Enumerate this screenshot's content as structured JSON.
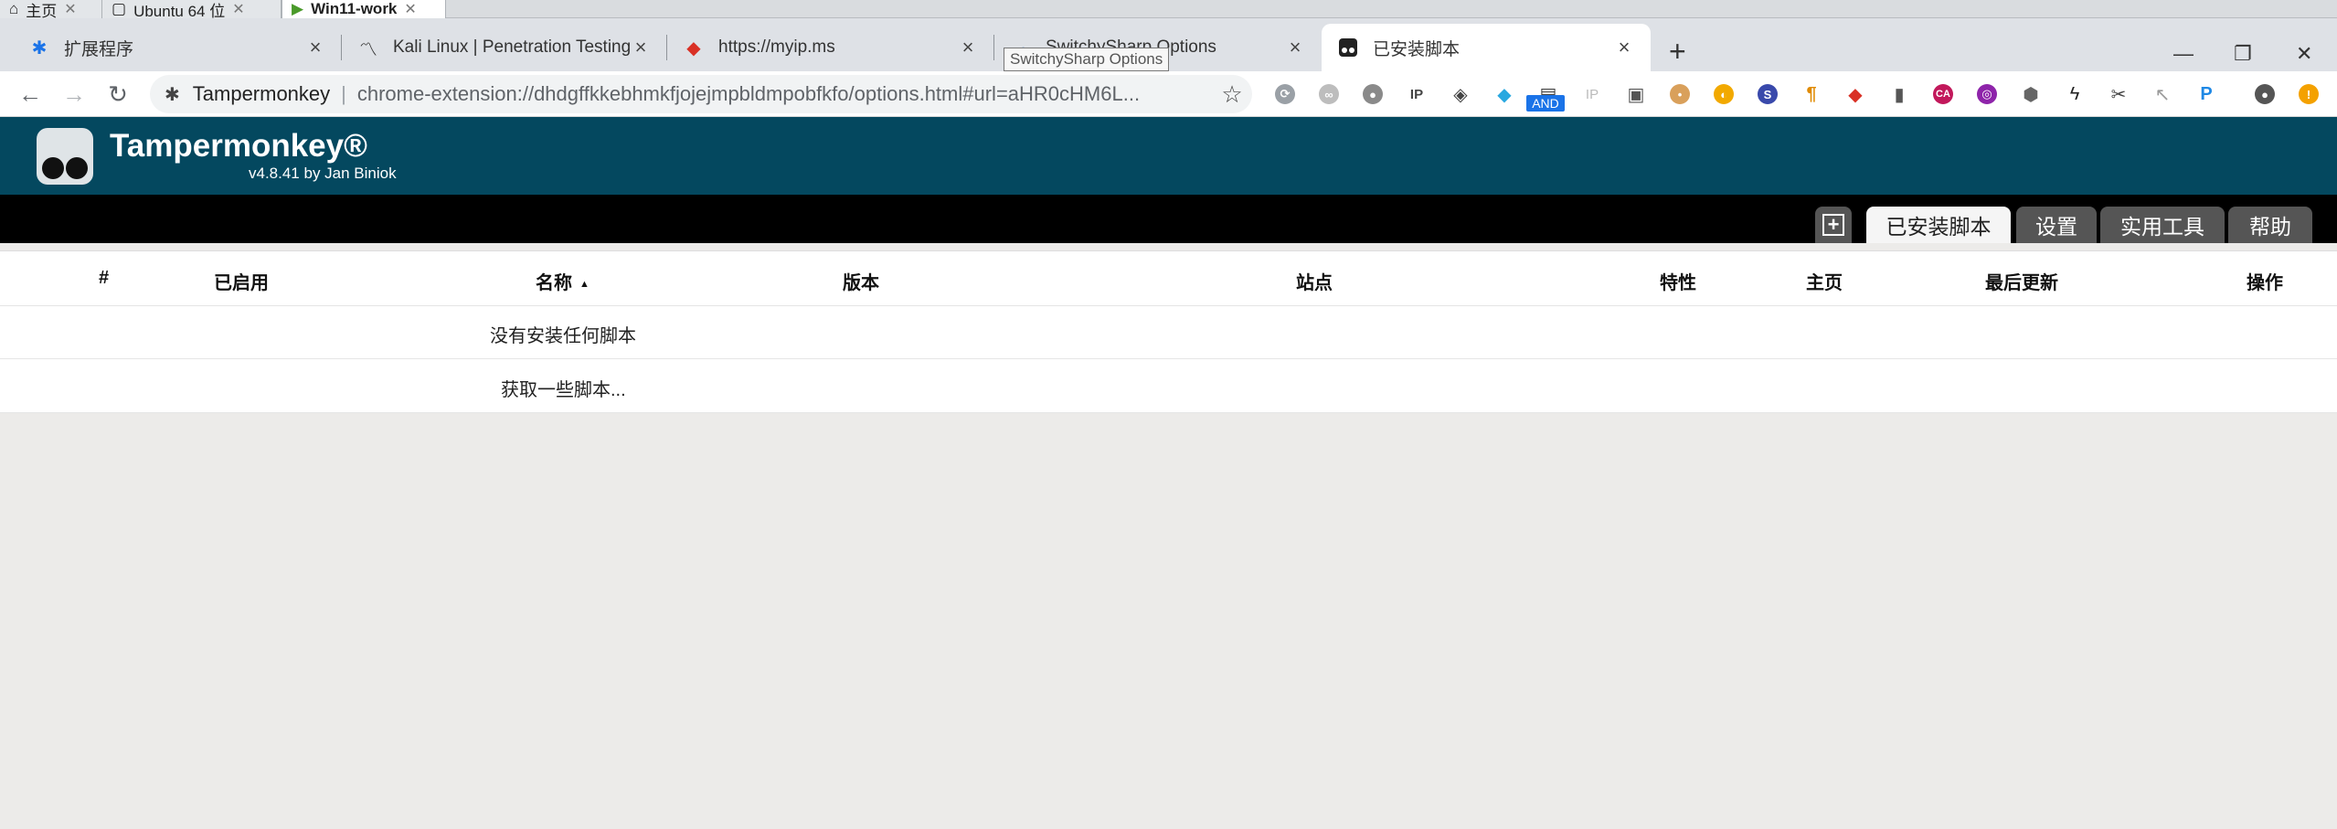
{
  "vm_tabs": [
    {
      "label": "主页",
      "icon": "home-icon"
    },
    {
      "label": "Ubuntu 64 位",
      "icon": "vm-icon"
    },
    {
      "label": "Win11-work",
      "icon": "vm-running-icon"
    }
  ],
  "browser_tabs": [
    {
      "title": "扩展程序",
      "icon": "puzzle-icon"
    },
    {
      "title": "Kali Linux | Penetration Testing",
      "icon": "kali-dragon-icon"
    },
    {
      "title": "https://myip.ms",
      "icon": "myip-icon"
    },
    {
      "title": "SwitchySharp Options",
      "icon": "switchysharp-icon"
    },
    {
      "title": "已安装脚本",
      "icon": "tampermonkey-icon"
    }
  ],
  "tooltip": "SwitchySharp Options",
  "address_bar": {
    "origin": "Tampermonkey",
    "url": "chrome-extension://dhdgffkkebhmkfjojejmpbldmpobfkfo/options.html#url=aHR0cHM6L..."
  },
  "extension_badge": "AND",
  "extension_icons": [
    "proxy-icon",
    "ghost-icon",
    "globe-icon",
    "ip-icon",
    "layers-icon",
    "diamond-icon",
    "and-icon",
    "ip-grey-icon",
    "tampermonkey-ext-icon",
    "cookie-icon",
    "flame-icon",
    "s-icon",
    "pilcrow-icon",
    "myip-ext-icon",
    "notebook-icon",
    "ca-icon",
    "hackbar-icon",
    "cube-icon",
    "bolt-icon",
    "scissors-icon",
    "cursor-icon",
    "p-icon"
  ],
  "tampermonkey": {
    "title": "Tampermonkey®",
    "version": "v4.8.41 by Jan Biniok"
  },
  "tm_tabs": [
    "已安装脚本",
    "设置",
    "实用工具",
    "帮助"
  ],
  "table": {
    "headers": [
      "#",
      "已启用",
      "名称",
      "版本",
      "站点",
      "特性",
      "主页",
      "最后更新",
      "操作"
    ],
    "sort_indicator": "▲",
    "empty_message": "没有安装任何脚本",
    "get_scripts_link": "获取一些脚本..."
  },
  "colors": {
    "header_bg": "#04485f",
    "tab_bar_bg": "#000000",
    "page_bg": "#ecebe9"
  }
}
